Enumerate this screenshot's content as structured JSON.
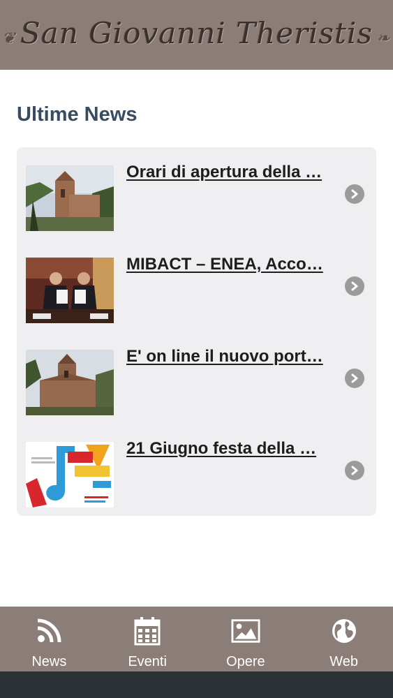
{
  "header": {
    "logo_text": "San Giovanni Theristis"
  },
  "section": {
    "title": "Ultime News"
  },
  "news": [
    {
      "title": "Orari di apertura della …",
      "thumb": "church-photo"
    },
    {
      "title": "MIBACT – ENEA, Acco…",
      "thumb": "signing-ceremony-photo"
    },
    {
      "title": "E' on line il nuovo port…",
      "thumb": "church-photo"
    },
    {
      "title": "21 Giugno festa della …",
      "thumb": "festa-della-musica-poster"
    }
  ],
  "nav": [
    {
      "label": "News",
      "icon": "rss-icon"
    },
    {
      "label": "Eventi",
      "icon": "calendar-icon"
    },
    {
      "label": "Opere",
      "icon": "image-icon"
    },
    {
      "label": "Web",
      "icon": "globe-icon"
    }
  ],
  "colors": {
    "header_bg": "#8b7d77",
    "title_color": "#394b60",
    "card_bg": "#efeef1",
    "chevron": "#9b9b9b"
  }
}
